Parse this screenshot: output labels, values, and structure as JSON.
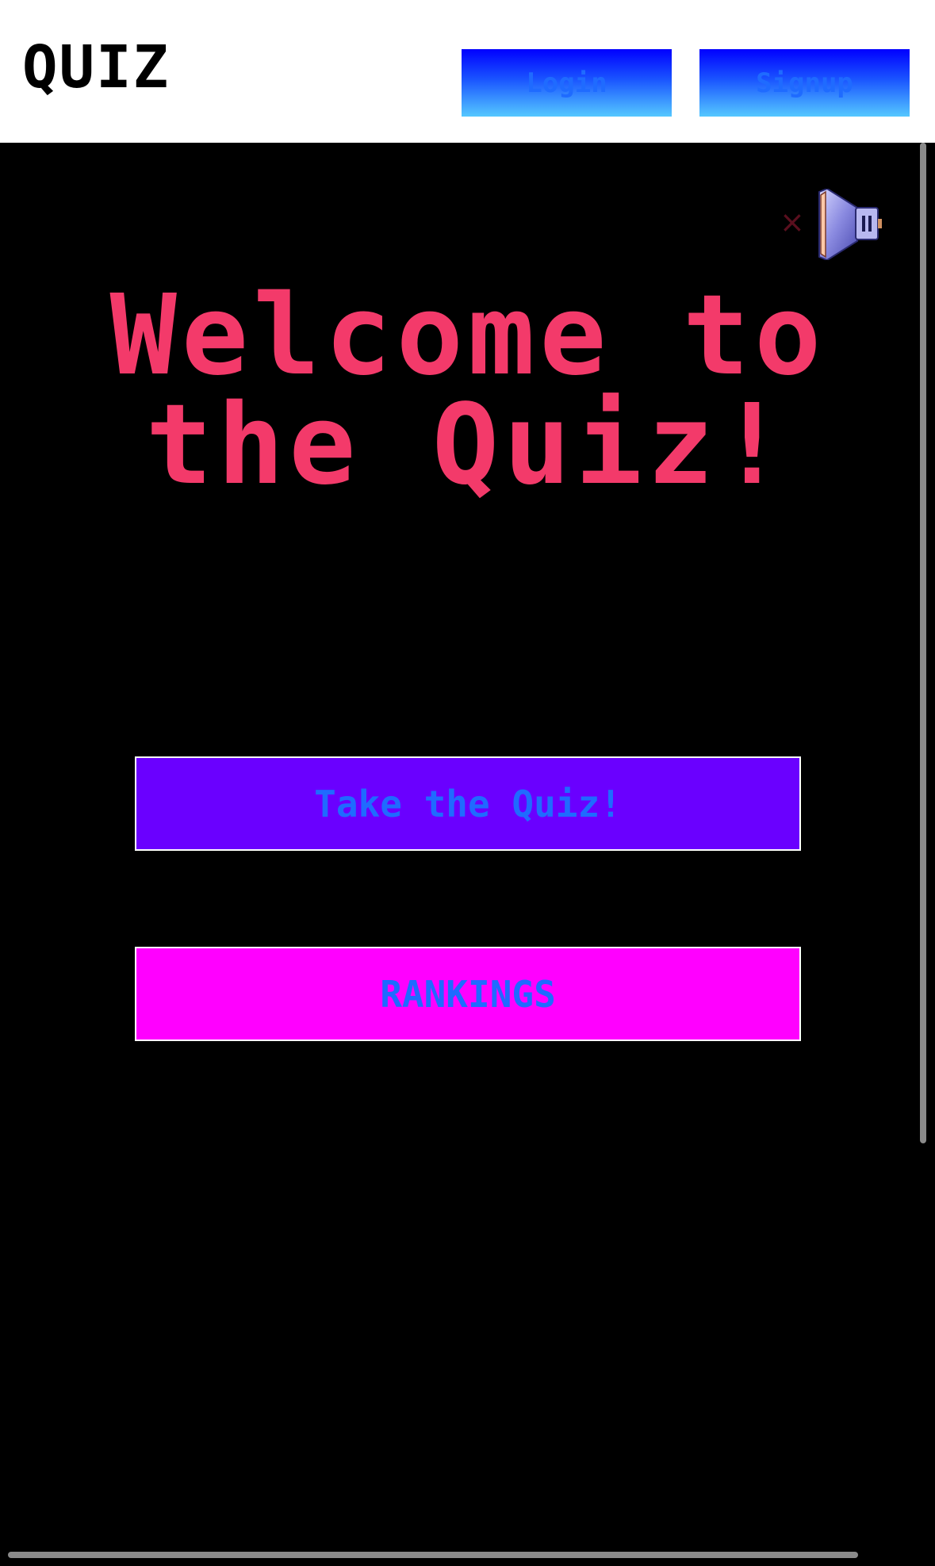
{
  "header": {
    "logo": "QUIZ",
    "login_label": "Login",
    "signup_label": "Signup"
  },
  "main": {
    "welcome_title": "Welcome to the Quiz!",
    "take_quiz_label": "Take the Quiz!",
    "rankings_label": "RANKINGS"
  },
  "sound": {
    "icon": "speaker-muted-icon",
    "mute_mark": "×"
  },
  "colors": {
    "header_bg": "#ffffff",
    "page_bg": "#000000",
    "title": "#f33a6a",
    "button_text": "#1f6bff",
    "take_quiz_bg": "#6a00ff",
    "rankings_bg": "#ff00ff"
  }
}
